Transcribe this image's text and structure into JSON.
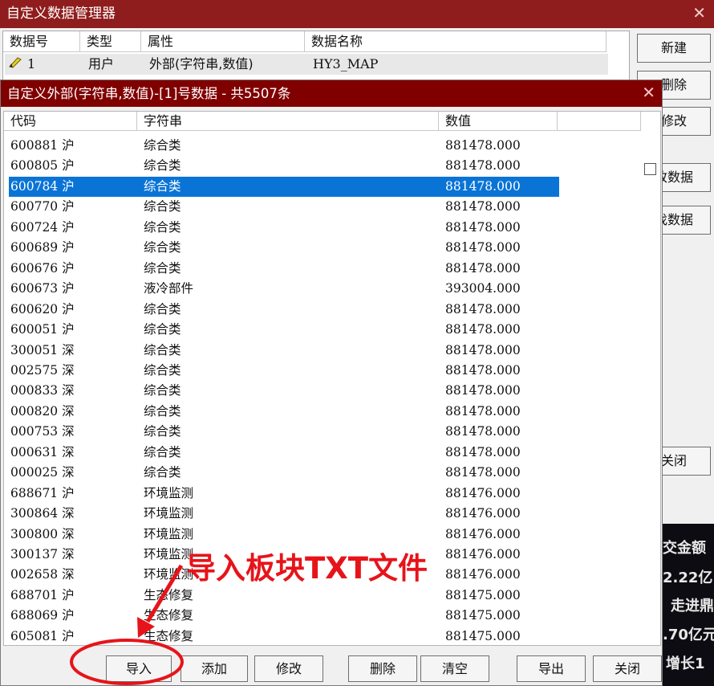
{
  "background_window": {
    "title": "自定义数据管理器",
    "columns": [
      "数据号",
      "类型",
      "属性",
      "数据名称"
    ],
    "row": {
      "id": "1",
      "type": "用户",
      "attr": "外部(字符串,数值)",
      "name": "HY3_MAP"
    },
    "buttons": {
      "new": "新建",
      "delete": "删除",
      "modify": "修改",
      "btn4": "改数据",
      "btn5": "找数据",
      "close": "关闭"
    },
    "dark_panel": [
      "交金额",
      "2.22亿",
      "走进鼎",
      ".70亿元",
      "增长1"
    ]
  },
  "dialog": {
    "title": "自定义外部(字符串,数值)-[1]号数据 - 共5507条",
    "close_symbol": "✕",
    "columns": [
      "代码",
      "字符串",
      "数值"
    ],
    "selected_index": 2,
    "rows": [
      {
        "code": "600881 沪",
        "str": "综合类",
        "val": "881478.000"
      },
      {
        "code": "600805 沪",
        "str": "综合类",
        "val": "881478.000"
      },
      {
        "code": "600784 沪",
        "str": "综合类",
        "val": "881478.000"
      },
      {
        "code": "600770 沪",
        "str": "综合类",
        "val": "881478.000"
      },
      {
        "code": "600724 沪",
        "str": "综合类",
        "val": "881478.000"
      },
      {
        "code": "600689 沪",
        "str": "综合类",
        "val": "881478.000"
      },
      {
        "code": "600676 沪",
        "str": "综合类",
        "val": "881478.000"
      },
      {
        "code": "600673 沪",
        "str": "液冷部件",
        "val": "393004.000"
      },
      {
        "code": "600620 沪",
        "str": "综合类",
        "val": "881478.000"
      },
      {
        "code": "600051 沪",
        "str": "综合类",
        "val": "881478.000"
      },
      {
        "code": "300051 深",
        "str": "综合类",
        "val": "881478.000"
      },
      {
        "code": "002575 深",
        "str": "综合类",
        "val": "881478.000"
      },
      {
        "code": "000833 深",
        "str": "综合类",
        "val": "881478.000"
      },
      {
        "code": "000820 深",
        "str": "综合类",
        "val": "881478.000"
      },
      {
        "code": "000753 深",
        "str": "综合类",
        "val": "881478.000"
      },
      {
        "code": "000631 深",
        "str": "综合类",
        "val": "881478.000"
      },
      {
        "code": "000025 深",
        "str": "综合类",
        "val": "881478.000"
      },
      {
        "code": "688671 沪",
        "str": "环境监测",
        "val": "881476.000"
      },
      {
        "code": "300864 深",
        "str": "环境监测",
        "val": "881476.000"
      },
      {
        "code": "300800 深",
        "str": "环境监测",
        "val": "881476.000"
      },
      {
        "code": "300137 深",
        "str": "环境监测",
        "val": "881476.000"
      },
      {
        "code": "002658 深",
        "str": "环境监测",
        "val": "881476.000"
      },
      {
        "code": "688701 沪",
        "str": "生态修复",
        "val": "881475.000"
      },
      {
        "code": "688069 沪",
        "str": "生态修复",
        "val": "881475.000"
      },
      {
        "code": "605081 沪",
        "str": "生态修复",
        "val": "881475.000"
      }
    ],
    "buttons": {
      "import": "导入",
      "add": "添加",
      "modify": "修改",
      "delete": "删除",
      "clear": "清空",
      "export": "导出",
      "close": "关闭"
    }
  },
  "annotation": {
    "text": "导入板块TXT文件",
    "color": "#e6141a"
  }
}
